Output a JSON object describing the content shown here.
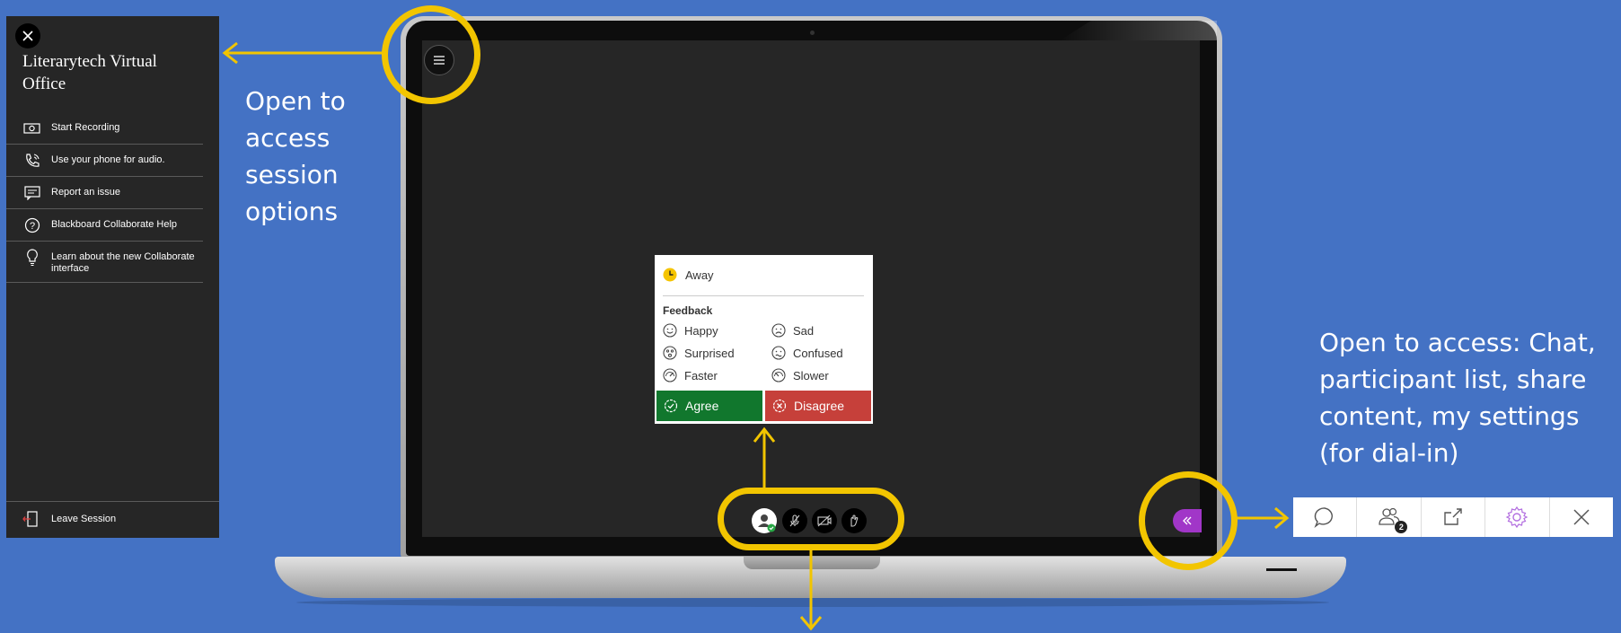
{
  "session_panel": {
    "title": "Literarytech Virtual Office",
    "items": [
      {
        "label": "Start Recording",
        "icon": "record-icon"
      },
      {
        "label": "Use your phone for audio.",
        "icon": "phone-icon"
      },
      {
        "label": "Report an issue",
        "icon": "report-icon"
      },
      {
        "label": "Blackboard Collaborate Help",
        "icon": "help-icon"
      },
      {
        "label": "Learn about the new Collaborate interface",
        "icon": "lightbulb-icon"
      }
    ],
    "leave_label": "Leave Session"
  },
  "annotations": {
    "session_options": "Open to access session options",
    "panel_access": "Open to access: Chat, participant list, share content, my settings (for dial-in)"
  },
  "status_menu": {
    "away_label": "Away",
    "feedback_heading": "Feedback",
    "options": [
      {
        "label": "Happy",
        "icon": "happy-icon"
      },
      {
        "label": "Sad",
        "icon": "sad-icon"
      },
      {
        "label": "Surprised",
        "icon": "surprised-icon"
      },
      {
        "label": "Confused",
        "icon": "confused-icon"
      },
      {
        "label": "Faster",
        "icon": "faster-icon"
      },
      {
        "label": "Slower",
        "icon": "slower-icon"
      }
    ],
    "agree_label": "Agree",
    "disagree_label": "Disagree"
  },
  "right_toolbar": {
    "participant_count": "2",
    "items": [
      "chat-icon",
      "participants-icon",
      "share-content-icon",
      "settings-icon",
      "close-icon"
    ]
  },
  "colors": {
    "background": "#4472C4",
    "highlight": "#F2C500",
    "agree": "#11772D",
    "disagree": "#C6403A",
    "panel_toggle": "#A136C8",
    "settings_accent": "#B36FE0"
  }
}
